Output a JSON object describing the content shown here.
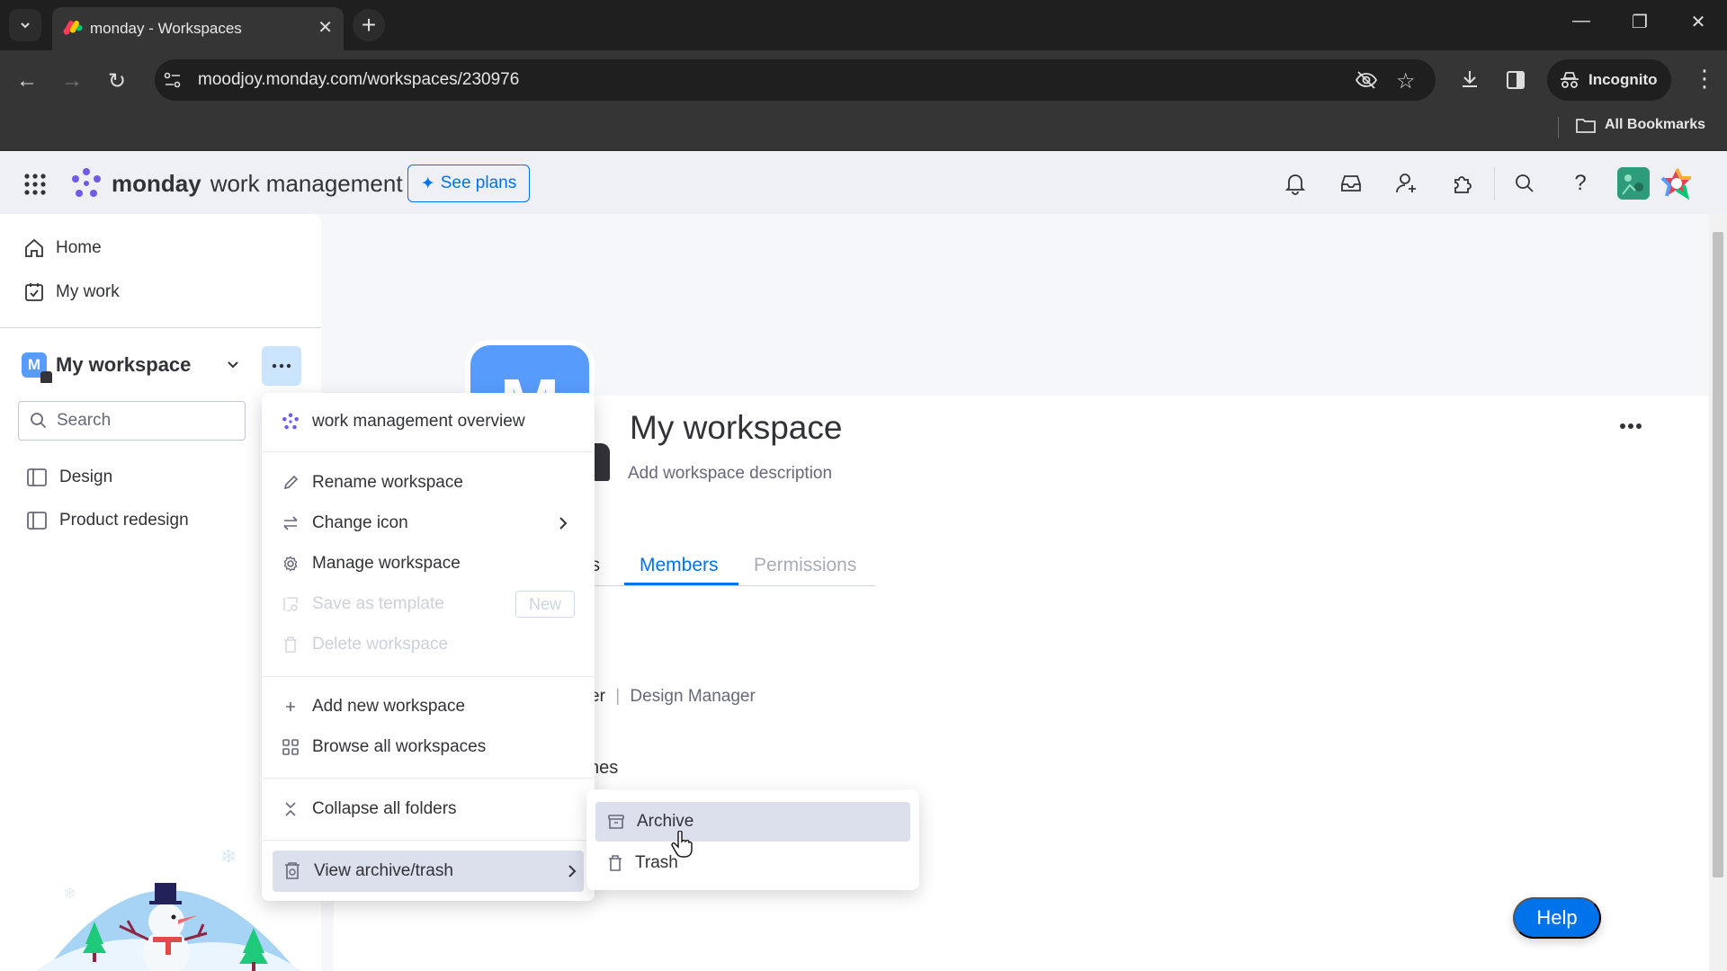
{
  "browser": {
    "tab_title": "monday - Workspaces",
    "url": "moodjoy.monday.com/workspaces/230976",
    "incognito_label": "Incognito",
    "bookmarks_label": "All Bookmarks",
    "new_tab": "+",
    "tab_close": "✕"
  },
  "header": {
    "brand_bold": "monday",
    "brand_light": "work management",
    "see_plans": "See plans",
    "icons": [
      "notifications-icon",
      "inbox-icon",
      "invite-members-icon",
      "apps-icon",
      "search-icon",
      "help-icon"
    ]
  },
  "sidebar": {
    "nav": [
      {
        "label": "Home",
        "icon": "home-icon"
      },
      {
        "label": "My work",
        "icon": "my-work-icon"
      }
    ],
    "workspace": {
      "initial": "M",
      "name": "My workspace"
    },
    "search_placeholder": "Search",
    "boards": [
      {
        "label": "Design"
      },
      {
        "label": "Product redesign"
      }
    ]
  },
  "menu": {
    "overview": "work management overview",
    "items": [
      {
        "label": "Rename workspace",
        "icon": "pencil-icon",
        "enabled": true
      },
      {
        "label": "Change icon",
        "icon": "swap-icon",
        "enabled": true,
        "submenu": true
      },
      {
        "label": "Manage workspace",
        "icon": "gear-icon",
        "enabled": true
      },
      {
        "label": "Save as template",
        "icon": "template-icon",
        "enabled": false,
        "badge": "New"
      },
      {
        "label": "Delete workspace",
        "icon": "trash-icon",
        "enabled": false
      },
      {
        "label": "Add new workspace",
        "icon": "plus-icon",
        "enabled": true
      },
      {
        "label": "Browse all workspaces",
        "icon": "grid-icon",
        "enabled": true
      },
      {
        "label": "Collapse all folders",
        "icon": "collapse-icon",
        "enabled": true
      },
      {
        "label": "View archive/trash",
        "icon": "archive-trash-icon",
        "enabled": true,
        "submenu": true,
        "active": true
      }
    ]
  },
  "submenu": {
    "items": [
      {
        "label": "Archive",
        "icon": "archive-icon",
        "hover": true
      },
      {
        "label": "Trash",
        "icon": "trash-icon"
      }
    ]
  },
  "main": {
    "avatar_initial": "M",
    "title": "My workspace",
    "description_placeholder": "Add workspace description",
    "tabs": [
      {
        "label": "ls",
        "partial": true
      },
      {
        "label": "Members",
        "active": true
      },
      {
        "label": "Permissions"
      }
    ],
    "member_role_partial": "er",
    "member_title": "Design Manager",
    "section_partial": "nes",
    "help_button": "Help"
  },
  "colors": {
    "primary": "#0073ea",
    "workspace_avatar": "#579bfc",
    "menu_active_bg": "#dcdfec",
    "text": "#323338",
    "muted_text": "#676879"
  }
}
